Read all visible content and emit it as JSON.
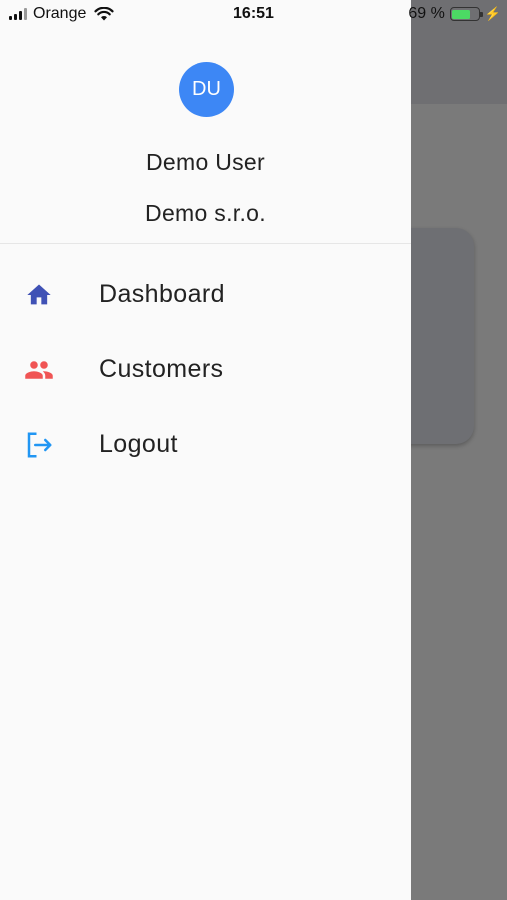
{
  "status_bar": {
    "carrier": "Orange",
    "time": "16:51",
    "battery_percent": "69 %",
    "battery_level": 0.69,
    "signal_bars": 3
  },
  "drawer": {
    "avatar_initials": "DU",
    "user_name": "Demo User",
    "company_name": "Demo s.r.o.",
    "avatar_color": "#3d87f5",
    "items": [
      {
        "label": "Dashboard",
        "icon": "home-icon",
        "icon_color": "#3f51b5"
      },
      {
        "label": "Customers",
        "icon": "people-icon",
        "icon_color": "#f05454"
      },
      {
        "label": "Logout",
        "icon": "logout-icon",
        "icon_color": "#2196f3"
      }
    ]
  }
}
